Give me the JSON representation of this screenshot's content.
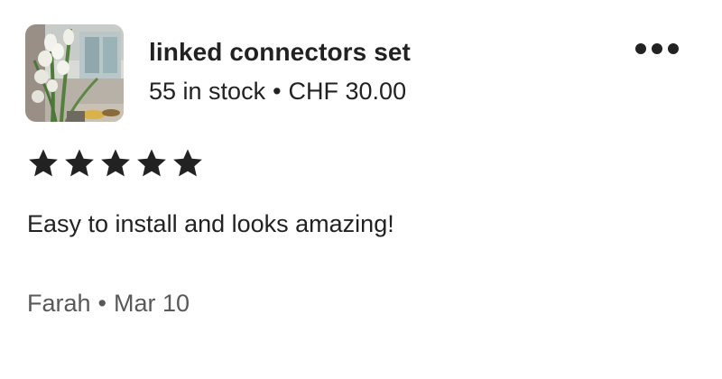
{
  "product": {
    "title": "linked connectors set",
    "stock": "55 in stock",
    "separator": "•",
    "price": "CHF 30.00",
    "image_icon": "product-photo-flowers"
  },
  "menu": {
    "icon": "more-options-icon"
  },
  "rating": {
    "value": 5,
    "max": 5,
    "star_color": "#222222"
  },
  "review": {
    "text": "Easy to install and looks amazing!"
  },
  "footer": {
    "author": "Farah",
    "separator": "•",
    "date": "Mar 10"
  }
}
